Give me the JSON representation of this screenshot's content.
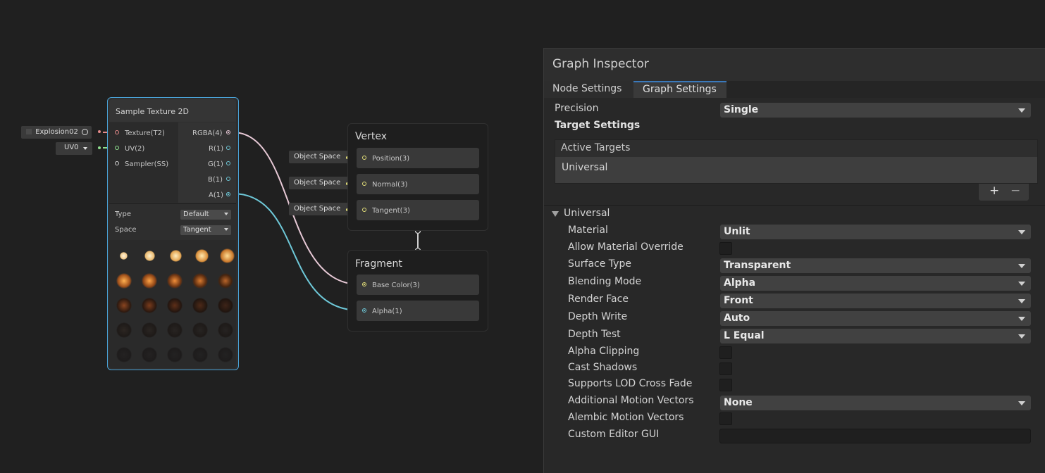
{
  "graph": {
    "property_chip": {
      "label": "Explosion02"
    },
    "uv_select": {
      "label": "UV0"
    },
    "sample_node": {
      "title": "Sample Texture 2D",
      "inputs": [
        "Texture(T2)",
        "UV(2)",
        "Sampler(SS)"
      ],
      "outputs": [
        "RGBA(4)",
        "R(1)",
        "G(1)",
        "B(1)",
        "A(1)"
      ],
      "type_label": "Type",
      "type_value": "Default",
      "space_label": "Space",
      "space_value": "Tangent"
    },
    "vertex_block": {
      "title": "Vertex",
      "slots": [
        "Position(3)",
        "Normal(3)",
        "Tangent(3)"
      ],
      "space_chips": [
        "Object Space",
        "Object Space",
        "Object Space"
      ]
    },
    "fragment_block": {
      "title": "Fragment",
      "slots": [
        "Base Color(3)",
        "Alpha(1)"
      ]
    },
    "colors": {
      "texture_wire": "#e58a8a",
      "uv_wire": "#8fe08f",
      "rgba_wire": "#e7c9d6",
      "alpha_wire": "#6ec8d8",
      "vector_port": "#e6e27a",
      "node_selected_border": "#4aa3d8"
    }
  },
  "inspector": {
    "title": "Graph Inspector",
    "tabs": [
      "Node Settings",
      "Graph Settings"
    ],
    "active_tab": "Graph Settings",
    "precision": {
      "label": "Precision",
      "value": "Single"
    },
    "target_settings_label": "Target Settings",
    "active_targets": {
      "header": "Active Targets",
      "items": [
        "Universal"
      ],
      "add_icon": "plus-icon",
      "remove_icon": "minus-icon"
    },
    "universal_section": "Universal",
    "settings": [
      {
        "label": "Material",
        "type": "dropdown",
        "value": "Unlit"
      },
      {
        "label": "Allow Material Override",
        "type": "checkbox",
        "checked": false
      },
      {
        "label": "Surface Type",
        "type": "dropdown",
        "value": "Transparent"
      },
      {
        "label": "Blending Mode",
        "type": "dropdown",
        "value": "Alpha"
      },
      {
        "label": "Render Face",
        "type": "dropdown",
        "value": "Front"
      },
      {
        "label": "Depth Write",
        "type": "dropdown",
        "value": "Auto"
      },
      {
        "label": "Depth Test",
        "type": "dropdown",
        "value": "L Equal"
      },
      {
        "label": "Alpha Clipping",
        "type": "checkbox",
        "checked": false
      },
      {
        "label": "Cast Shadows",
        "type": "checkbox",
        "checked": false
      },
      {
        "label": "Supports LOD Cross Fade",
        "type": "checkbox",
        "checked": false
      },
      {
        "label": "Additional Motion Vectors",
        "type": "dropdown",
        "value": "None"
      },
      {
        "label": "Alembic Motion Vectors",
        "type": "checkbox",
        "checked": false
      },
      {
        "label": "Custom Editor GUI",
        "type": "text",
        "value": ""
      }
    ]
  }
}
